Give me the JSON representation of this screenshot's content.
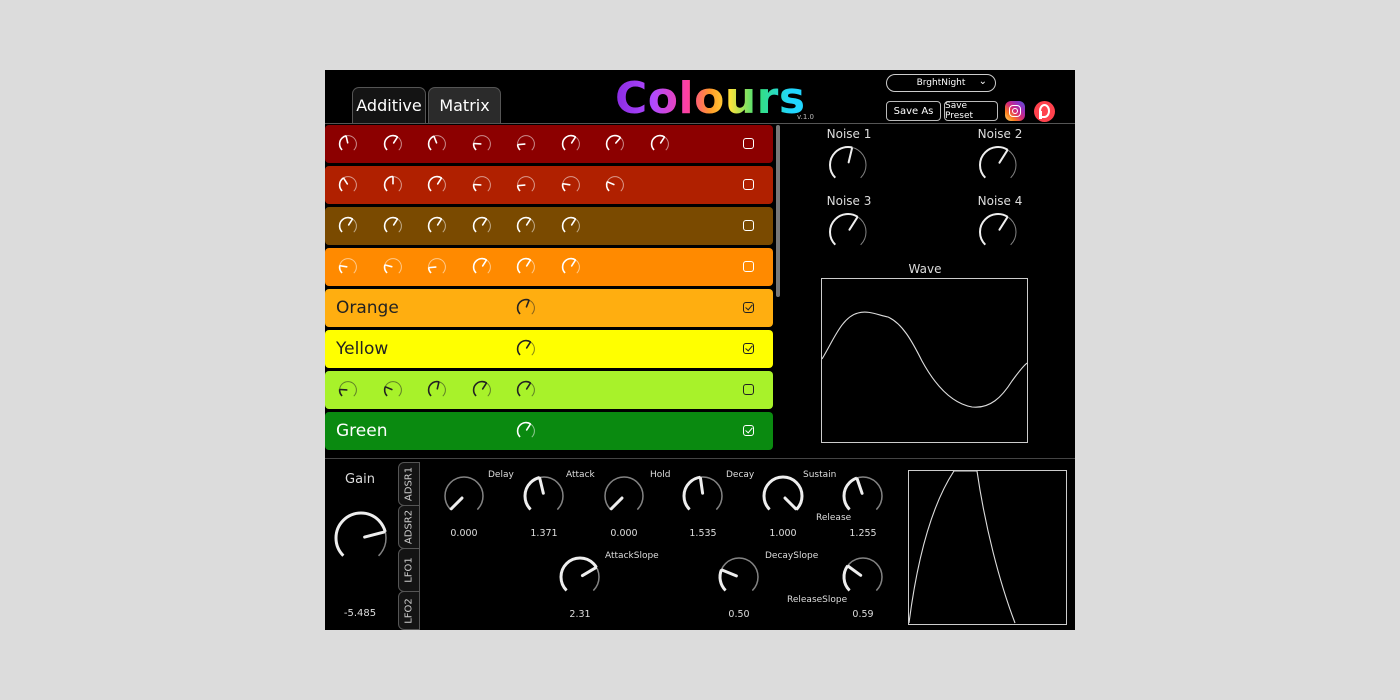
{
  "header": {
    "tabs": [
      {
        "label": "Additive"
      },
      {
        "label": "Matrix"
      }
    ],
    "app_title": "Colours",
    "version": "v.1.0",
    "preset_name": "BrghtNight",
    "save_as_label": "Save As",
    "save_preset_label": "Save Preset"
  },
  "rows": [
    {
      "color": "#8c0000",
      "label": "",
      "checked": false,
      "knobs": [
        0.45,
        0.62,
        0.42,
        0.18,
        0.15,
        0.62,
        0.65,
        0.62
      ]
    },
    {
      "color": "#b02000",
      "label": "",
      "checked": false,
      "knobs": [
        0.38,
        0.5,
        0.62,
        0.18,
        0.15,
        0.2,
        0.25
      ]
    },
    {
      "color": "#7a4a00",
      "label": "",
      "checked": false,
      "knobs": [
        0.62,
        0.62,
        0.62,
        0.62,
        0.62,
        0.62
      ]
    },
    {
      "color": "#ff8a00",
      "label": "",
      "checked": false,
      "knobs": [
        0.2,
        0.22,
        0.15,
        0.62,
        0.62,
        0.62
      ]
    },
    {
      "color": "#ffae10",
      "label": "Orange",
      "checked": true,
      "knobs": [
        null,
        null,
        null,
        null,
        0.58
      ]
    },
    {
      "color": "#ffff00",
      "label": "Yellow",
      "checked": true,
      "knobs": [
        null,
        null,
        null,
        null,
        0.62
      ]
    },
    {
      "color": "#a8f22a",
      "label": "",
      "checked": false,
      "knobs": [
        0.18,
        0.25,
        0.55,
        0.62,
        0.62
      ]
    },
    {
      "color": "#0a8a10",
      "label": "Green",
      "checked": true,
      "knobs": [
        null,
        null,
        null,
        null,
        0.62
      ]
    }
  ],
  "noise": [
    {
      "label": "Noise 1",
      "value": 0.55
    },
    {
      "label": "Noise 2",
      "value": 0.62
    },
    {
      "label": "Noise 3",
      "value": 0.62
    },
    {
      "label": "Noise 4",
      "value": 0.62
    }
  ],
  "wave": {
    "label": "Wave"
  },
  "gain": {
    "label": "Gain",
    "value": "-5.485",
    "level": 0.78
  },
  "side_tabs": [
    {
      "label": "ADSR1"
    },
    {
      "label": "ADSR2"
    },
    {
      "label": "LFO1"
    },
    {
      "label": "LFO2"
    }
  ],
  "envelope_params": [
    {
      "label": "Delay",
      "value": "0.000",
      "level": 0.0
    },
    {
      "label": "Attack",
      "value": "1.371",
      "level": 0.45
    },
    {
      "label": "Hold",
      "value": "0.000",
      "level": 0.0
    },
    {
      "label": "Decay",
      "value": "1.535",
      "level": 0.47
    },
    {
      "label": "Sustain",
      "value": "1.000",
      "level": 1.0
    },
    {
      "label": "Release",
      "value": "1.255",
      "level": 0.43
    }
  ],
  "slope_params": [
    {
      "label": "AttackSlope",
      "value": "2.31",
      "level": 0.72
    },
    {
      "label": "DecaySlope",
      "value": "0.50",
      "level": 0.25
    },
    {
      "label": "ReleaseSlope",
      "value": "0.59",
      "level": 0.3
    }
  ]
}
